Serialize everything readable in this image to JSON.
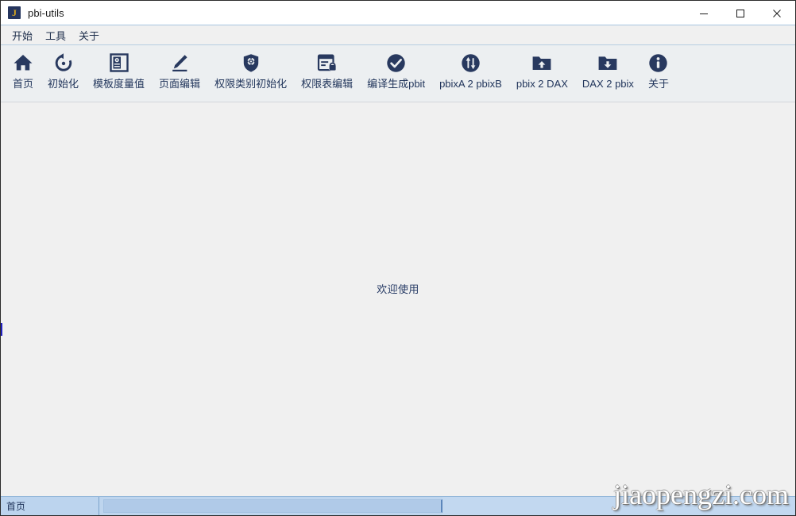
{
  "window": {
    "title": "pbi-utils",
    "app_icon_glyph": "J",
    "controls": [
      {
        "name": "minimize-button",
        "label": "—"
      },
      {
        "name": "maximize-button",
        "label": "□"
      },
      {
        "name": "close-button",
        "label": "✕"
      }
    ]
  },
  "menu": {
    "items": [
      {
        "label": "开始",
        "name": "menu-item-start"
      },
      {
        "label": "工具",
        "name": "menu-item-tools"
      },
      {
        "label": "关于",
        "name": "menu-item-about"
      }
    ]
  },
  "toolbar": {
    "buttons": [
      {
        "label": "首页",
        "icon": "home-icon"
      },
      {
        "label": "初始化",
        "icon": "reset-circular-arrow-icon"
      },
      {
        "label": "模板度量值",
        "icon": "template-measure-panel-icon"
      },
      {
        "label": "页面编辑",
        "icon": "pencil-edit-icon"
      },
      {
        "label": "权限类别初始化",
        "icon": "shield-gear-icon"
      },
      {
        "label": "权限表编辑",
        "icon": "table-lock-icon"
      },
      {
        "label": "编译生成pbit",
        "icon": "check-circle-icon"
      },
      {
        "label": "pbixA 2 pbixB",
        "icon": "transfer-arrows-circle-icon"
      },
      {
        "label": "pbix 2 DAX",
        "icon": "folder-upload-icon"
      },
      {
        "label": "DAX 2 pbix",
        "icon": "folder-download-icon"
      },
      {
        "label": "关于",
        "icon": "info-circle-icon"
      }
    ]
  },
  "content": {
    "welcome_text": "欢迎使用"
  },
  "watermark": {
    "text": "jiaopengzi.com"
  },
  "status_bar": {
    "cell_text": "首页"
  },
  "colors": {
    "icon_navy": "#28395f",
    "label_navy": "#22365c",
    "toolbar_bg": "#eceff1",
    "content_bg": "#f0f0f0",
    "status_bg": "#bed5ee",
    "status_progress": "#b0cae8",
    "app_icon_bg": "#25355e",
    "app_icon_letter": "#d5a520"
  }
}
